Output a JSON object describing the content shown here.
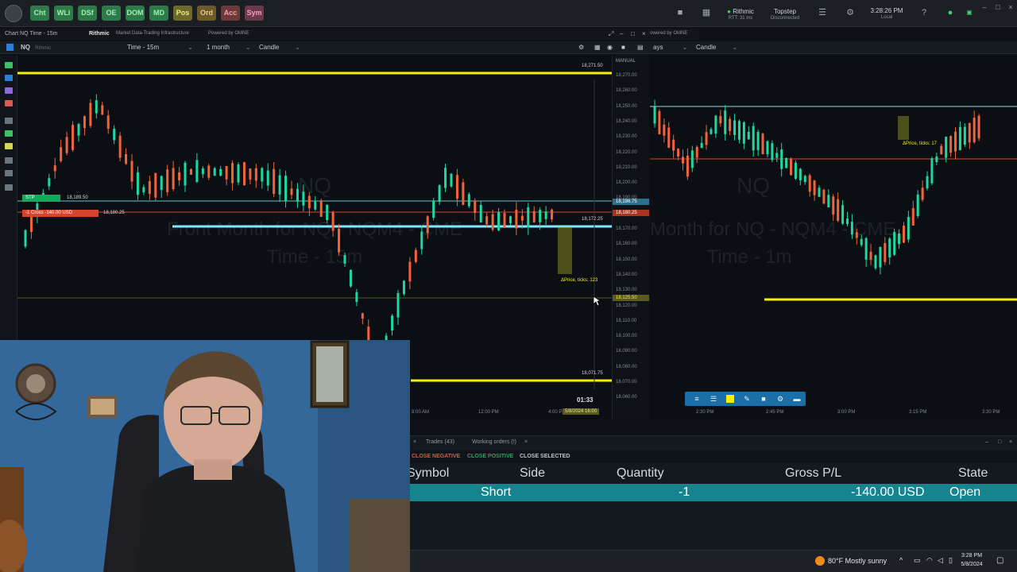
{
  "toolbar": {
    "buttons": [
      {
        "label": "Cht",
        "bg": "#2f7a4a",
        "fg": "#9ff0b0"
      },
      {
        "label": "WLi",
        "bg": "#2f7a4a",
        "fg": "#9ff0b0"
      },
      {
        "label": "DSf",
        "bg": "#2f7a4a",
        "fg": "#9ff0b0"
      },
      {
        "label": "OE",
        "bg": "#2f7a4a",
        "fg": "#9ff0b0"
      },
      {
        "label": "DOM",
        "bg": "#2f7a4a",
        "fg": "#9ff0b0"
      },
      {
        "label": "MD",
        "bg": "#2f7a4a",
        "fg": "#9ff0b0"
      },
      {
        "label": "Pos",
        "bg": "#6b6a2a",
        "fg": "#f2ea8a"
      },
      {
        "label": "Ord",
        "bg": "#6b5a2a",
        "fg": "#f2c48a"
      },
      {
        "label": "Acc",
        "bg": "#6b3a3a",
        "fg": "#f2a0a0"
      },
      {
        "label": "Sym",
        "bg": "#6b3a4a",
        "fg": "#f2a0c0"
      }
    ],
    "rithmic_label": "Rithmic",
    "rithmic_sub": "RTT: 31 ms",
    "topstep_label": "Topstep",
    "topstep_sub": "Disconnected",
    "clock_time": "3:28:26 PM",
    "clock_sub": "Local"
  },
  "chart_window": {
    "title": "Chart NQ Time - 15m",
    "provider": "Rithmic",
    "provider_tag": "Market Data-Trading Infrastructure",
    "powered": "Powered by OMNE",
    "powered_right": "owered by OMNE"
  },
  "chart_toolbar": {
    "symbol": "NQ",
    "symbol_hint": "Rithmic",
    "timeframe": "Time - 15m",
    "range": "1 month",
    "style": "Candle",
    "right_timeframe": "ays",
    "right_style": "Candle"
  },
  "left_chart": {
    "watermark_symbol": "NQ",
    "watermark_line1": "Front Month for NQ - NQM4 - CME",
    "watermark_line2": "Time - 15m",
    "price_high_label": "18,271.50",
    "price_low_label": "18,071.75",
    "price_current_label": "18,172.25",
    "price_ticks_note": "ΔPrice, ticks: 123",
    "stp_label": "STP",
    "stp_price": "18,189.50",
    "sell_label": "-1 Cross -140.00 USD",
    "sell_price": "18,180.25",
    "countdown": "01:33",
    "axis_label": "MANUAL",
    "y_ticks": [
      "18,270.00",
      "18,260.00",
      "18,250.00",
      "18,240.00",
      "18,230.00",
      "18,220.00",
      "18,210.00",
      "18,200.00",
      "18,190.00",
      "18,180.00",
      "18,170.00",
      "18,160.00",
      "18,150.00",
      "18,140.00",
      "18,130.00",
      "18,120.00",
      "18,110.00",
      "18,100.00",
      "18,090.00",
      "18,080.00",
      "18,070.00",
      "18,060.00"
    ],
    "tag_stp": "18,186.75",
    "tag_sell": "18,180.25",
    "tag_cursor": "18,125.50",
    "x_ticks": [
      "8:00 AM",
      "12:00 PM",
      "4:00 PM"
    ],
    "x_current": "5/8/2024 16:00"
  },
  "right_chart": {
    "watermark_symbol": "NQ",
    "watermark_line1": "Month for NQ - NQM4 - CME",
    "watermark_line2": "Time - 1m",
    "ticks_note": "ΔPrice, ticks: 17",
    "x_ticks": [
      "2:30 PM",
      "2:45 PM",
      "3:00 PM",
      "3:15 PM",
      "3:30 PM"
    ]
  },
  "bottom_panel": {
    "tab_trades": "Trades (43)",
    "tab_orders": "Working orders (!)",
    "btn_close_negative": "CLOSE NEGATIVE",
    "btn_close_positive": "CLOSE POSITIVE",
    "btn_close_selected": "CLOSE SELECTED",
    "headers": {
      "symbol": "Symbol",
      "side": "Side",
      "quantity": "Quantity",
      "gross": "Gross P/L",
      "state": "State"
    },
    "row": {
      "side": "Short",
      "quantity": "-1",
      "gross": "-140.00 USD",
      "state": "Open"
    }
  },
  "taskbar": {
    "weather": "80°F  Mostly sunny",
    "time": "3:28 PM",
    "date": "5/8/2024"
  },
  "colors": {
    "accent_yellow": "#f4f000",
    "accent_cyan": "#7fe7ff",
    "bull": "#1ed8a0",
    "bear": "#f0643c"
  }
}
